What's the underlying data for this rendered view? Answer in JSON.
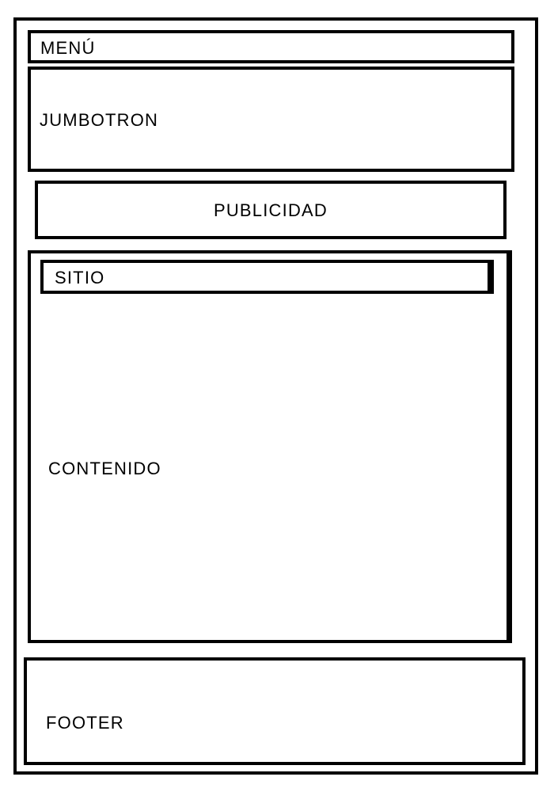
{
  "wireframe": {
    "menu": {
      "label": "MENÚ"
    },
    "jumbotron": {
      "label": "JUMBOTRON"
    },
    "publicidad": {
      "label": "PUBLICIDAD"
    },
    "sitio": {
      "label": "SITIO"
    },
    "contenido": {
      "label": "CONTENIDO"
    },
    "footer": {
      "label": "FOOTER"
    }
  },
  "colors": {
    "stroke": "#000000",
    "background": "#ffffff"
  }
}
